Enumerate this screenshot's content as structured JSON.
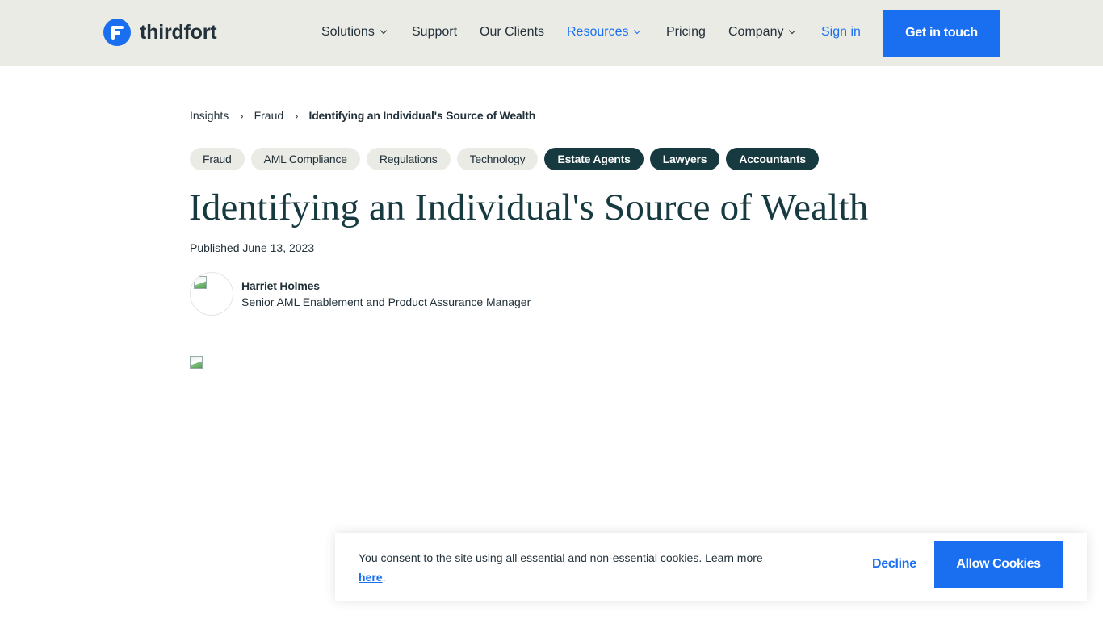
{
  "header": {
    "logo_text": "thirdfort",
    "nav": [
      {
        "label": "Solutions",
        "has_dropdown": true
      },
      {
        "label": "Support",
        "has_dropdown": false
      },
      {
        "label": "Our Clients",
        "has_dropdown": false
      },
      {
        "label": "Resources",
        "has_dropdown": true,
        "active": true
      },
      {
        "label": "Pricing",
        "has_dropdown": false
      },
      {
        "label": "Company",
        "has_dropdown": true
      }
    ],
    "sign_in": "Sign in",
    "cta": "Get in touch"
  },
  "breadcrumb": {
    "items": [
      "Insights",
      "Fraud"
    ],
    "separator": "›",
    "current": "Identifying an Individual's Source of Wealth"
  },
  "tags": [
    {
      "label": "Fraud",
      "style": "light"
    },
    {
      "label": "AML Compliance",
      "style": "light"
    },
    {
      "label": "Regulations",
      "style": "light"
    },
    {
      "label": "Technology",
      "style": "light"
    },
    {
      "label": "Estate Agents",
      "style": "dark"
    },
    {
      "label": "Lawyers",
      "style": "dark"
    },
    {
      "label": "Accountants",
      "style": "dark"
    }
  ],
  "article": {
    "title": "Identifying an Individual's Source of Wealth",
    "published": "Published June 13, 2023",
    "author": {
      "name": "Harriet Holmes",
      "role": "Senior AML Enablement and Product Assurance Manager"
    }
  },
  "cookie_banner": {
    "text": "You consent to the site using all essential and non-essential cookies. Learn more",
    "link_text": "here",
    "trailing": ".",
    "decline_label": "Decline",
    "allow_label": "Allow Cookies"
  },
  "colors": {
    "accent_blue": "#1a6ff0",
    "dark_teal": "#163a40",
    "header_bg": "#ebebe6"
  },
  "icons": {
    "logo": "thirdfort-logo-icon",
    "dropdown": "chevron-down-icon",
    "breadcrumb_separator": "chevron-right-icon",
    "broken_image": "broken-image-icon"
  }
}
